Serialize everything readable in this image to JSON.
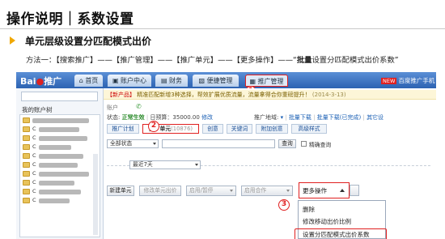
{
  "slide": {
    "title": "操作说明｜系数设置",
    "section_heading": "单元层级设置分匹配模式出价",
    "method_line": {
      "prefix": "方法一：【搜索推广】——【推广管理】——【推广单元】——【更多操作】——“",
      "bold": "批量",
      "suffix": "设置分匹配模式出价系数”"
    }
  },
  "screenshot": {
    "logo": {
      "text": "Bai",
      "paw": "推广"
    },
    "nav_tabs": [
      {
        "icon": "⌂",
        "label": "首页"
      },
      {
        "icon": "▣",
        "label": "账户中心"
      },
      {
        "icon": "▤",
        "label": "财务"
      },
      {
        "icon": "▧",
        "label": "便捷管理"
      },
      {
        "icon": "▦",
        "label": "推广管理"
      }
    ],
    "nav_right": {
      "badge": "NEW",
      "text": "百度推广手机"
    },
    "sidebar": {
      "label": "我的账户树",
      "tree_char": "C"
    },
    "notice": {
      "tag": "【新产品】",
      "text": "精准匹配新增3种选择，帮效扩展优质流量，流量拿得合你重磅提升！",
      "date": "(2014-3-13)"
    },
    "account_label": "账户",
    "status": {
      "prefix": "状态:",
      "value": "正常生效",
      "budget_label": "日预算：",
      "budget_value": "35000.00",
      "edit_link": "修改"
    },
    "region": {
      "label": "推广地域:",
      "link1": "批量下载",
      "link2": "批量下载(已完成)",
      "link3": "其它设"
    },
    "subtabs": [
      {
        "label": "推广计划",
        "count": ""
      },
      {
        "label": "推广单元",
        "count": "(10876)"
      },
      {
        "label": "创意",
        "count": ""
      },
      {
        "label": "关键词",
        "count": ""
      },
      {
        "label": "附加创意",
        "count": ""
      },
      {
        "label": "高级样式",
        "count": ""
      }
    ],
    "filter": {
      "status_select": "全部状态",
      "search_button": "查询",
      "exact_search_label": "精确查询"
    },
    "date_select": "最近7天",
    "actions": {
      "new_unit": "新建单元",
      "edit_bid": "修改单元出价",
      "enable_pause": "启用/暂停",
      "enable_cooperation": "启用合作",
      "more_ops": "更多操作"
    },
    "dropdown": [
      "删除",
      "修改移动出价比例",
      "设置分匹配模式出价系数"
    ],
    "steps": [
      "1",
      "2",
      "3"
    ]
  }
}
